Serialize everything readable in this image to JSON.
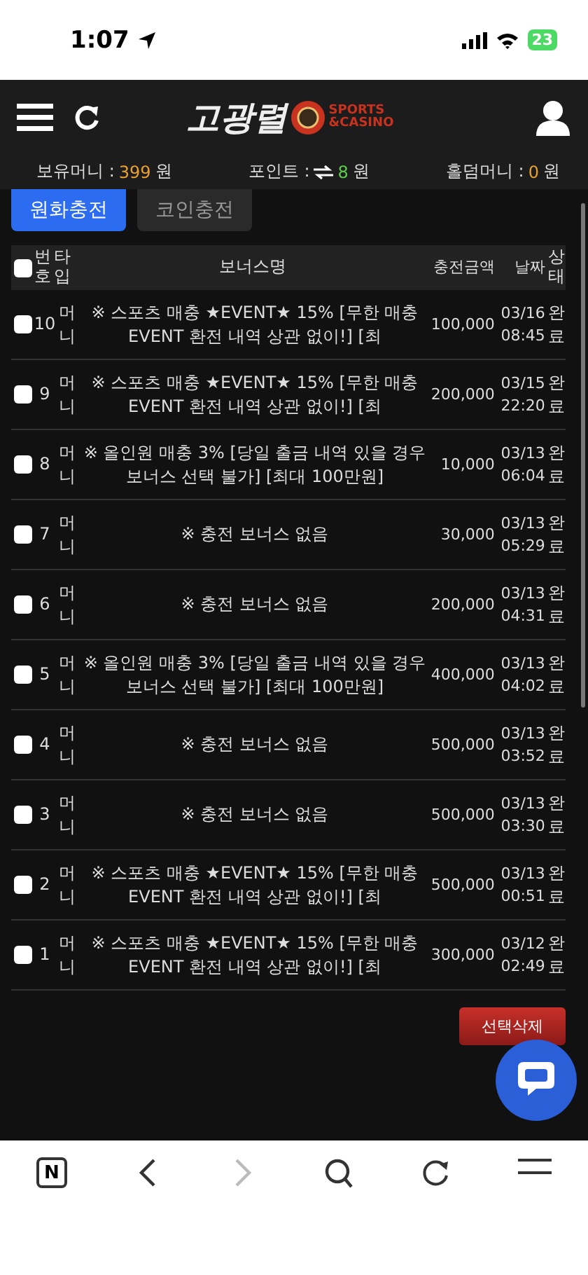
{
  "status_bar": {
    "time": "1:07",
    "battery": "23"
  },
  "header": {
    "logo_text": "고광렬",
    "logo_sub": [
      "SPORTS",
      "&CASINO"
    ]
  },
  "balances": [
    {
      "label": "보유머니 :",
      "value": "399",
      "unit": "원",
      "kind": "money"
    },
    {
      "label": "포인트 :",
      "value": "8",
      "unit": "원",
      "kind": "point"
    },
    {
      "label": "홀덤머니 :",
      "value": "0",
      "unit": "원",
      "kind": "money"
    }
  ],
  "tabs": [
    {
      "label": "원화충전",
      "selected": true
    },
    {
      "label": "코인충전",
      "selected": false
    }
  ],
  "table": {
    "select_all_checked": false,
    "columns": [
      "번호",
      "타입",
      "보너스명",
      "충전금액",
      "날짜",
      "상태"
    ],
    "rows": [
      {
        "checked": false,
        "number": "10",
        "type": "머니",
        "bonus": "※ 스포츠 매충 ★EVENT★ 15% [무한 매충 EVENT 환전 내역 상관 없이!] [최",
        "amount": "100,000",
        "date": "03/16 08:45",
        "status": "완료"
      },
      {
        "checked": false,
        "number": "9",
        "type": "머니",
        "bonus": "※ 스포츠 매충 ★EVENT★ 15% [무한 매충 EVENT 환전 내역 상관 없이!] [최",
        "amount": "200,000",
        "date": "03/15 22:20",
        "status": "완료"
      },
      {
        "checked": false,
        "number": "8",
        "type": "머니",
        "bonus": "※ 올인원 매충 3% [당일 출금 내역 있을 경우 보너스 선택 불가] [최대 100만원]",
        "amount": "10,000",
        "date": "03/13 06:04",
        "status": "완료"
      },
      {
        "checked": false,
        "number": "7",
        "type": "머니",
        "bonus": "※ 충전 보너스 없음",
        "amount": "30,000",
        "date": "03/13 05:29",
        "status": "완료"
      },
      {
        "checked": false,
        "number": "6",
        "type": "머니",
        "bonus": "※ 충전 보너스 없음",
        "amount": "200,000",
        "date": "03/13 04:31",
        "status": "완료"
      },
      {
        "checked": false,
        "number": "5",
        "type": "머니",
        "bonus": "※ 올인원 매충 3% [당일 출금 내역 있을 경우 보너스 선택 불가] [최대 100만원]",
        "amount": "400,000",
        "date": "03/13 04:02",
        "status": "완료"
      },
      {
        "checked": false,
        "number": "4",
        "type": "머니",
        "bonus": "※ 충전 보너스 없음",
        "amount": "500,000",
        "date": "03/13 03:52",
        "status": "완료"
      },
      {
        "checked": false,
        "number": "3",
        "type": "머니",
        "bonus": "※ 충전 보너스 없음",
        "amount": "500,000",
        "date": "03/13 03:30",
        "status": "완료"
      },
      {
        "checked": false,
        "number": "2",
        "type": "머니",
        "bonus": "※ 스포츠 매충 ★EVENT★ 15% [무한 매충 EVENT 환전 내역 상관 없이!] [최",
        "amount": "500,000",
        "date": "03/13 00:51",
        "status": "완료"
      },
      {
        "checked": false,
        "number": "1",
        "type": "머니",
        "bonus": "※ 스포츠 매충 ★EVENT★ 15% [무한 매충 EVENT 환전 내역 상관 없이!] [최",
        "amount": "300,000",
        "date": "03/12 02:49",
        "status": "완료"
      }
    ]
  },
  "delete_button": "선택삭제",
  "browser_bar": {
    "logo_letter": "N"
  }
}
